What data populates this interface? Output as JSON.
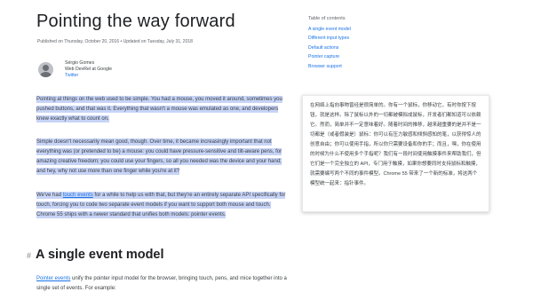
{
  "article": {
    "title": "Pointing the way forward",
    "meta": "Published on Thursday, October 20, 2016 • Updated on Tuesday, July 31, 2018",
    "author": {
      "name": "Sérgio Gomes",
      "role": "Web DevRel at Google",
      "link": "Twitter"
    },
    "p1": "Pointing at things on the web used to be simple. You had a mouse, you moved it around, sometimes you pushed buttons, and that was it. Everything that wasn't a mouse was emulated as one, and developers knew exactly what to count on.",
    "p2": "Simple doesn't necessarily mean good, though. Over time, it became increasingly important that not everything was (or pretended to be) a mouse: you could have pressure-sensitive and tilt-aware pens, for amazing creative freedom; you could use your fingers, so all you needed was the device and your hand; and hey, why not use more than one finger while you're at it?",
    "p3_before": "We've had ",
    "p3_link": "touch events",
    "p3_after": " for a while to help us with that, but they're an entirely separate API specifically for touch, forcing you to code two separate event models if you want to support both mouse and touch. Chrome 55 ships with a newer standard that unifies both models: pointer events.",
    "section_hash": "#",
    "section_title": "A single event model",
    "p4_link": "Pointer events",
    "p4_after": " unify the pointer input model for the browser, bringing touch, pens, and mice together into a single set of events. For example:"
  },
  "toc": {
    "title": "Table of contents",
    "items": [
      "A single event model",
      "Different input types",
      "Default actions",
      "Pointer capture",
      "Browser support"
    ]
  },
  "translation_popup": {
    "text": "在网络上指向事物曾经是很简单的。你有一个鼠标，你移动它，有时你按下按钮，就是这样。除了鼠标以外的一切都被模拟成鼠标，开发者们都知道可以依赖它。然而，简单并不一定意味着好。随着时间的推移，越来越重要的是并不是一切都是（或者假装是）鼠标：你可以有压力敏感和倾斜感知的笔，以获得惊人的创意自由；你可以使用手指，所以你只需要设备和你的手；而且，嘿，你在使用的时候为什么不使用多个手指呢？我们有一段时间使用触摸事件来帮助我们，但它们是一个完全独立的 API，专门用于触摸，如果你想要同时支持鼠标和触摸，就需要编写两个不同的事件模型。Chrome 55 带来了一个新的标准，将这两个模型统一起来：指针事件。"
  }
}
